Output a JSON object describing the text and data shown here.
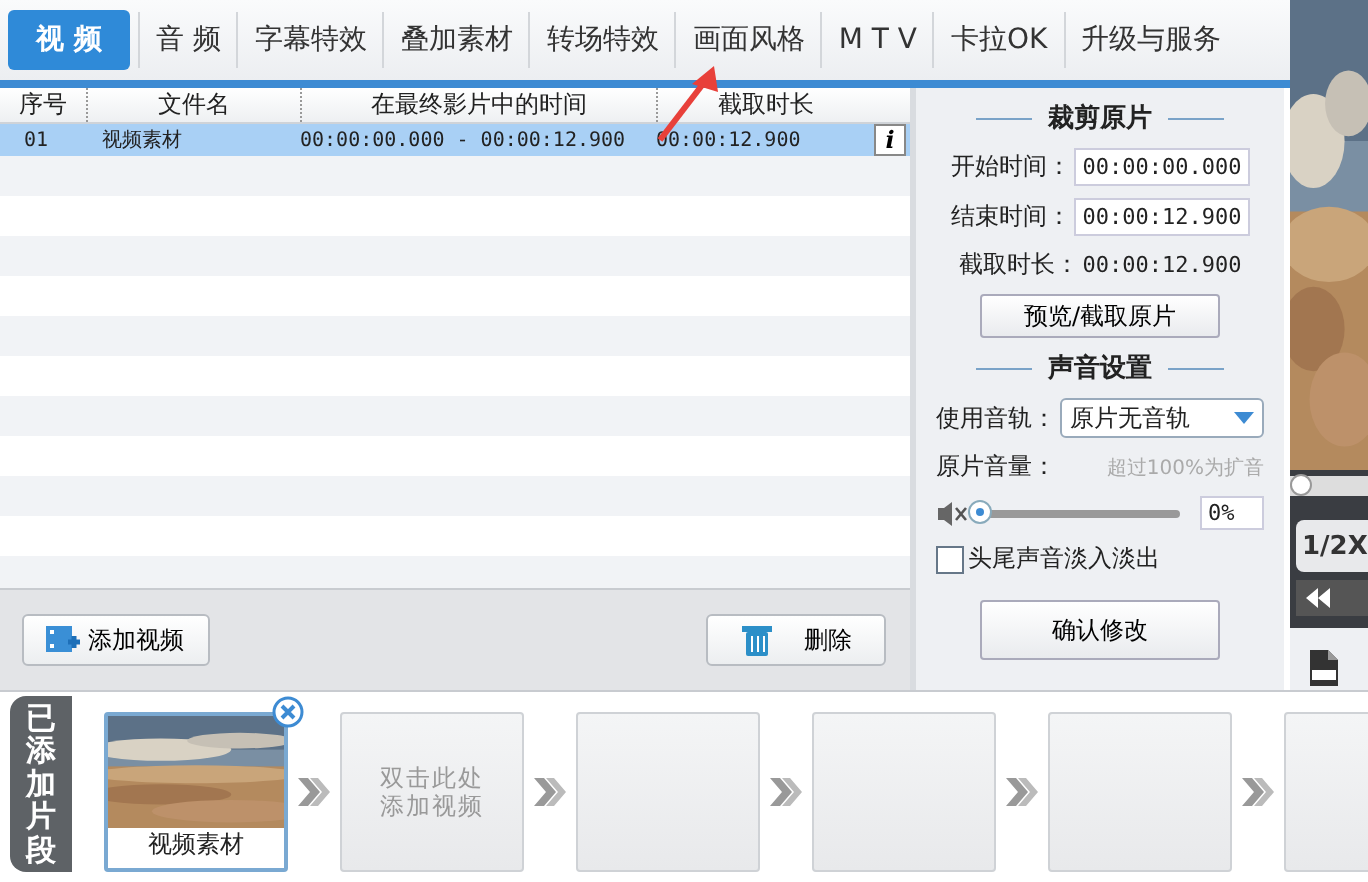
{
  "tabs": [
    {
      "label": "视 频",
      "selected": true
    },
    {
      "label": "音 频",
      "selected": false
    },
    {
      "label": "字幕特效",
      "selected": false
    },
    {
      "label": "叠加素材",
      "selected": false
    },
    {
      "label": "转场特效",
      "selected": false
    },
    {
      "label": "画面风格",
      "selected": false
    },
    {
      "label": "M T V",
      "selected": false
    },
    {
      "label": "卡拉OK",
      "selected": false
    },
    {
      "label": "升级与服务",
      "selected": false
    }
  ],
  "table": {
    "columns": [
      "序号",
      "文件名",
      "在最终影片中的时间",
      "截取时长"
    ],
    "rows": [
      {
        "cells": [
          "01",
          "视频素材",
          "00:00:00.000 - 00:00:12.900",
          "00:00:12.900"
        ],
        "info": "i",
        "selected": true
      }
    ]
  },
  "list_buttons": [
    {
      "kind": "add",
      "label": "添加视频"
    },
    {
      "kind": "delete",
      "label": "删除"
    }
  ],
  "trim": {
    "title": "裁剪原片",
    "start_label": "开始时间：",
    "start": "00:00:00.000",
    "end_label": "结束时间：",
    "end": "00:00:12.900",
    "duration_label": "截取时长：",
    "duration": "00:00:12.900",
    "preview_button": "预览/截取原片"
  },
  "audio": {
    "title": "声音设置",
    "track_label": "使用音轨：",
    "track": "原片无音轨",
    "volume_label": "原片音量：",
    "volume_hint": "超过100%为扩音",
    "muted": true,
    "volume": {
      "level": 0,
      "reading": "0%"
    },
    "fade": {
      "label": "头尾声音淡入淡出",
      "checked": false
    },
    "confirm_button": "确认修改"
  },
  "preview": {
    "progress": {
      "level": 0
    },
    "speed": "1/2X"
  },
  "timeline": {
    "tab": "已添加片段",
    "clips": [
      {
        "kind": "clip",
        "label": "视频素材"
      },
      {
        "kind": "empty",
        "hint_lines": [
          "双击此处",
          "添加视频"
        ]
      },
      {
        "kind": "empty"
      },
      {
        "kind": "empty"
      },
      {
        "kind": "empty"
      },
      {
        "kind": "empty"
      }
    ]
  }
}
